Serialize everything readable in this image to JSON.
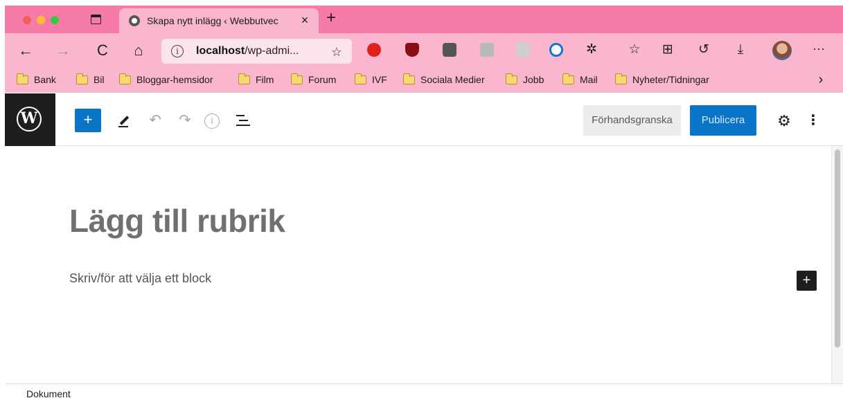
{
  "browser": {
    "tab": {
      "title": "Skapa nytt inlägg ‹ Webbutvec",
      "close_label": "×"
    },
    "new_tab_label": "+",
    "nav": {
      "back": "←",
      "forward": "→",
      "reload": "C",
      "home": "⌂"
    },
    "url": {
      "host": "localhost",
      "path": "/wp-admi..."
    },
    "bookmarks": [
      "Bank",
      "Bil",
      "Bloggar-hemsidor",
      "Film",
      "Forum",
      "IVF",
      "Sociala Medier",
      "Jobb",
      "Mail",
      "Nyheter/Tidningar"
    ],
    "bookmarks_more": "›",
    "more_menu": "···"
  },
  "editor": {
    "add_block_label": "+",
    "undo": "↶",
    "redo": "↷",
    "info": "i",
    "preview_label": "Förhandsgranska",
    "publish_label": "Publicera",
    "settings_icon": "gear-icon",
    "options_label": "⋮",
    "title_placeholder": "Lägg till rubrik",
    "block_prompt": "Skriv/för att välja ett block",
    "inserter_label": "+",
    "footer_label": "Dokument"
  },
  "colors": {
    "browser_chrome": "#fbb6cf",
    "tabbar": "#f77ba9",
    "wp_blue": "#0a74c7",
    "wp_dark": "#1e1e1e"
  }
}
